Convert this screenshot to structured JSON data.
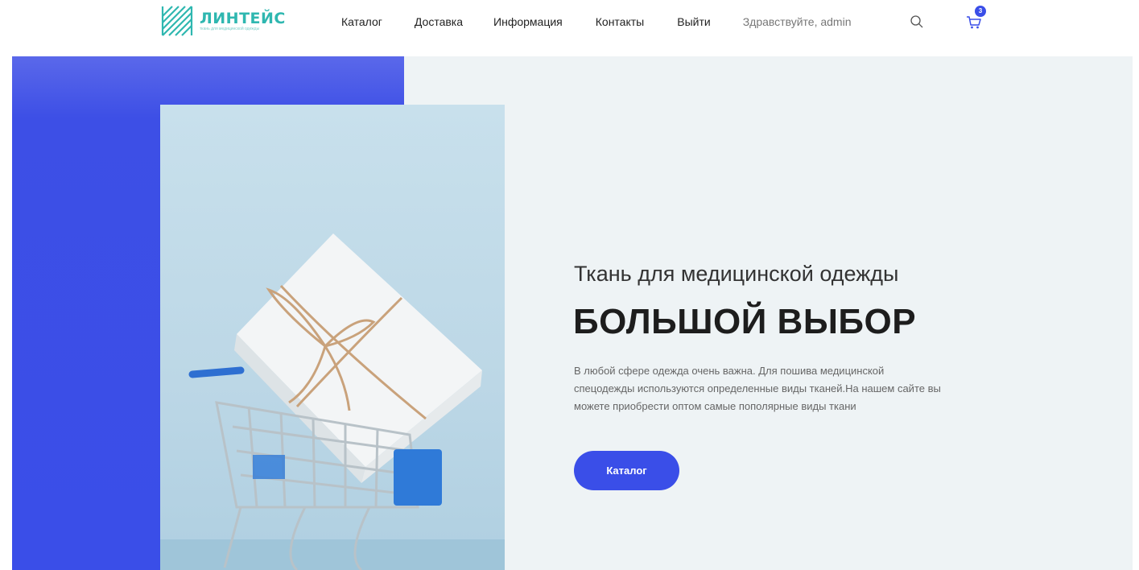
{
  "header": {
    "logo_title": "ЛИНТЕЙС",
    "logo_subtitle": "ткань для медицинской одежды",
    "nav": [
      "Каталог",
      "Доставка",
      "Информация",
      "Контакты",
      "Выйти"
    ],
    "greeting": "Здравствуйте, admin",
    "cart_count": "3",
    "search_icon": "search-icon",
    "cart_icon": "cart-icon"
  },
  "hero": {
    "subtitle": "Ткань для медицинской одежды",
    "title": "БОЛЬШОЙ ВЫБОР",
    "text": "В любой сфере одежда очень важна. Для пошива медицинской спецодежды используются определенные виды тканей.На нашем сайте вы можете приобрести оптом самые пополярные виды ткани",
    "button_label": "Каталог"
  },
  "colors": {
    "accent": "#3a4ee8",
    "logo": "#2fb7b0",
    "hero_bg": "#eef3f5"
  }
}
